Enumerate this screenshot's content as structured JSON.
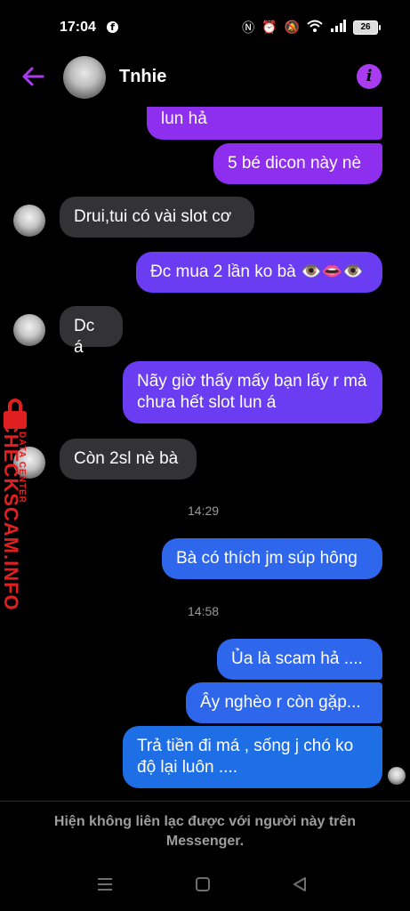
{
  "status_bar": {
    "time": "17:04",
    "battery": "26"
  },
  "header": {
    "contact_name": "Tnhie"
  },
  "messages": [
    {
      "text": "lun hả"
    },
    {
      "text": "5 bé dicon này nè"
    },
    {
      "text": "Drui,tui có vài slot cơ"
    },
    {
      "text": "Đc mua 2 lần ko bà 👁️👄👁️"
    },
    {
      "text": "Dc á"
    },
    {
      "text": "Nãy giờ thấy mấy bạn lấy r mà chưa hết slot lun á"
    },
    {
      "text": "Còn 2sl nè bà"
    },
    {
      "text": "Bà có thích jm súp hông"
    },
    {
      "text": "Ủa là scam hả ...."
    },
    {
      "text": "Ây nghèo r còn gặp..."
    },
    {
      "text": "Trả tiền đi má , sống j chó ko độ lại luôn ...."
    }
  ],
  "timestamps": [
    "14:29",
    "14:58"
  ],
  "watermark": {
    "main": "CHECKSCAM.INFO",
    "sub": "DATA CENTER"
  },
  "footer": {
    "notice": "Hiện không liên lạc được với người này trên Messenger."
  },
  "colors": {
    "accent": "#a93bf0",
    "bubble_purple": "#8e2ff0",
    "bubble_violet": "#6a3cf2",
    "bubble_blue": "#2f67ec",
    "bubble_incoming": "#333335",
    "watermark": "#e02020"
  },
  "icons": [
    "facebook-icon",
    "nfc-icon",
    "alarm-icon",
    "mute-icon",
    "wifi-icon",
    "signal-icon",
    "battery-icon",
    "back-arrow-icon",
    "info-icon",
    "recent-apps-icon",
    "home-icon",
    "back-icon",
    "lock-icon"
  ]
}
